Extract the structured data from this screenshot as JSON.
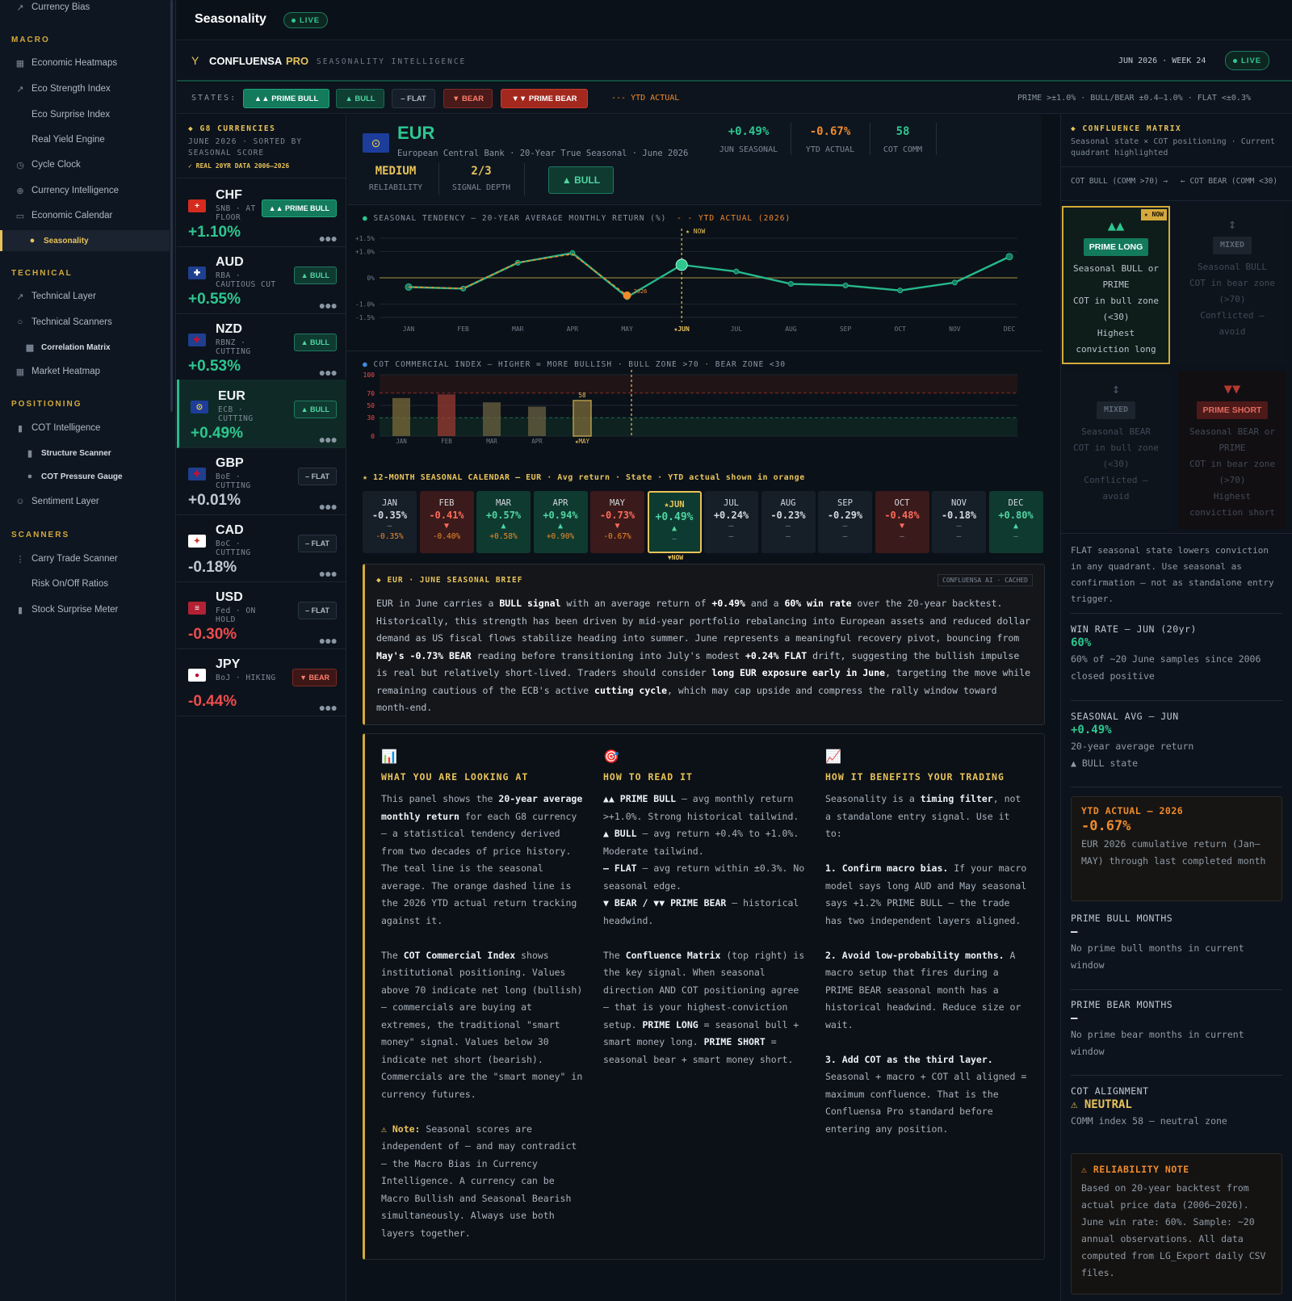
{
  "sidebar": {
    "top_item": "Currency Bias",
    "sections": [
      {
        "title": "MACRO",
        "items": [
          "Economic Heatmaps",
          "Eco Strength Index",
          "Eco Surprise Index",
          "Real Yield Engine",
          "Cycle Clock",
          "Currency Intelligence",
          "Economic Calendar",
          "Seasonality"
        ]
      },
      {
        "title": "TECHNICAL",
        "items": [
          "Technical Layer",
          "Technical Scanners",
          "Correlation Matrix",
          "Market Heatmap"
        ]
      },
      {
        "title": "POSITIONING",
        "items": [
          "COT Intelligence",
          "Structure Scanner",
          "COT Pressure Gauge",
          "Sentiment Layer"
        ]
      },
      {
        "title": "SCANNERS",
        "items": [
          "Carry Trade Scanner",
          "Risk On/Off Ratios",
          "Stock Surprise Meter"
        ]
      }
    ]
  },
  "header": {
    "title": "Seasonality",
    "live": "LIVE"
  },
  "brand": {
    "name": "CONFLUENSA",
    "pro": "PRO",
    "subtitle": "SEASONALITY INTELLIGENCE",
    "date": "JUN 2026 · WEEK 24",
    "live": "LIVE"
  },
  "states": {
    "label": "STATES:",
    "prime_bull": "▲▲ PRIME BULL",
    "bull": "▲ BULL",
    "flat": "– FLAT",
    "bear": "▼ BEAR",
    "prime_bear": "▼▼ PRIME BEAR",
    "ytd": "--- YTD ACTUAL",
    "legend": "PRIME >±1.0% · BULL/BEAR ±0.4–1.0% · FLAT <±0.3%"
  },
  "currencies": {
    "title": "G8 CURRENCIES",
    "subtitle": "JUNE 2026 · SORTED BY SEASONAL SCORE",
    "note": "✓ REAL 20YR DATA 2006–2026",
    "list": [
      {
        "code": "CHF",
        "desc": "SNB · AT FLOOR",
        "value": "+1.10%",
        "badge": "▲▲ PRIME BULL"
      },
      {
        "code": "AUD",
        "desc": "RBA · CAUTIOUS CUT",
        "value": "+0.55%",
        "badge": "▲ BULL"
      },
      {
        "code": "NZD",
        "desc": "RBNZ · CUTTING",
        "value": "+0.53%",
        "badge": "▲ BULL"
      },
      {
        "code": "EUR",
        "desc": "ECB · CUTTING",
        "value": "+0.49%",
        "badge": "▲ BULL"
      },
      {
        "code": "GBP",
        "desc": "BoE · CUTTING",
        "value": "+0.01%",
        "badge": "– FLAT"
      },
      {
        "code": "CAD",
        "desc": "BoC · CUTTING",
        "value": "-0.18%",
        "badge": "– FLAT"
      },
      {
        "code": "USD",
        "desc": "Fed · ON HOLD",
        "value": "-0.30%",
        "badge": "– FLAT"
      },
      {
        "code": "JPY",
        "desc": "BoJ · HIKING",
        "value": "-0.44%",
        "badge": "▼ BEAR"
      }
    ]
  },
  "detail": {
    "code": "EUR",
    "desc": "European Central Bank · 20-Year True Seasonal · June 2026",
    "stats": [
      {
        "value": "+0.49%",
        "label": "JUN SEASONAL"
      },
      {
        "value": "-0.67%",
        "label": "YTD ACTUAL"
      },
      {
        "value": "58",
        "label": "COT COMM"
      }
    ],
    "reliability": "MEDIUM",
    "reliability_label": "RELIABILITY",
    "depth": "2/3",
    "depth_label": "SIGNAL DEPTH",
    "state": "▲ BULL"
  },
  "chart_data": [
    {
      "type": "line",
      "title": "SEASONAL TENDENCY — 20-YEAR AVERAGE MONTHLY RETURN (%)",
      "legend_ytd": "- - YTD ACTUAL (2026)",
      "now_label": "★ NOW",
      "may_tag": "2026",
      "categories": [
        "JAN",
        "FEB",
        "MAR",
        "APR",
        "MAY",
        "★JUN",
        "JUL",
        "AUG",
        "SEP",
        "OCT",
        "NOV",
        "DEC"
      ],
      "yticks": [
        "+1.5%",
        "+1.0%",
        "0%",
        "-1.0%",
        "-1.5%"
      ],
      "ylim": [
        -1.5,
        1.5
      ],
      "series": [
        {
          "name": "Seasonal",
          "values": [
            -0.35,
            -0.41,
            0.57,
            0.94,
            -0.73,
            0.49,
            0.24,
            -0.23,
            -0.29,
            -0.48,
            -0.18,
            0.8
          ]
        },
        {
          "name": "YTD ACTUAL (2026)",
          "values": [
            -0.35,
            -0.4,
            0.58,
            0.9,
            -0.67
          ]
        }
      ]
    },
    {
      "type": "bar",
      "title": "COT COMMERCIAL INDEX — HIGHER = MORE BULLISH · BULL ZONE >70 · BEAR ZONE <30",
      "categories": [
        "JAN",
        "FEB",
        "MAR",
        "APR",
        "★MAY"
      ],
      "values": [
        62,
        68,
        55,
        48,
        58
      ],
      "yticks": [
        "100",
        "70",
        "50",
        "30",
        "0"
      ],
      "ylim": [
        0,
        100
      ],
      "label": "58"
    }
  ],
  "calendar": {
    "title": "★ 12-MONTH SEASONAL CALENDAR — EUR · Avg return · State · YTD actual shown in orange",
    "now": "▼NOW",
    "months": [
      {
        "m": "JAN",
        "v": "-0.35%",
        "a": "–",
        "y": "-0.35%"
      },
      {
        "m": "FEB",
        "v": "-0.41%",
        "a": "▼",
        "y": "-0.40%"
      },
      {
        "m": "MAR",
        "v": "+0.57%",
        "a": "▲",
        "y": "+0.58%"
      },
      {
        "m": "APR",
        "v": "+0.94%",
        "a": "▲",
        "y": "+0.90%"
      },
      {
        "m": "MAY",
        "v": "-0.73%",
        "a": "▼",
        "y": "-0.67%"
      },
      {
        "m": "★JUN",
        "v": "+0.49%",
        "a": "▲",
        "y": "–"
      },
      {
        "m": "JUL",
        "v": "+0.24%",
        "a": "–",
        "y": "–"
      },
      {
        "m": "AUG",
        "v": "-0.23%",
        "a": "–",
        "y": "–"
      },
      {
        "m": "SEP",
        "v": "-0.29%",
        "a": "–",
        "y": "–"
      },
      {
        "m": "OCT",
        "v": "-0.48%",
        "a": "▼",
        "y": "–"
      },
      {
        "m": "NOV",
        "v": "-0.18%",
        "a": "–",
        "y": "–"
      },
      {
        "m": "DEC",
        "v": "+0.80%",
        "a": "▲",
        "y": "–"
      }
    ]
  },
  "brief": {
    "title": "◆ EUR · JUNE SEASONAL BRIEF",
    "tag": "CONFLUENSA AI · CACHED"
  },
  "guide": {
    "c1_title": "WHAT YOU ARE LOOKING AT",
    "c2_title": "HOW TO READ IT",
    "c3_title": "HOW IT BENEFITS YOUR TRADING"
  },
  "matrix": {
    "title": "◆ CONFLUENCE MATRIX",
    "subtitle": "Seasonal state × COT positioning · Current quadrant highlighted",
    "col1": "COT BULL (COMM >70) →",
    "col2": "← COT BEAR (COMM <30)",
    "q1": {
      "arrows": "▲▲",
      "badge": "PRIME LONG",
      "now": "★ NOW",
      "text": [
        "Seasonal BULL or",
        "PRIME",
        "COT in bull zone",
        "(<30)",
        "Highest",
        "conviction long"
      ]
    },
    "q2": {
      "arrows": "↕",
      "badge": "MIXED",
      "text": [
        "Seasonal BULL",
        "COT in bear zone",
        "(>70)",
        "Conflicted —",
        "avoid"
      ]
    },
    "q3": {
      "arrows": "↕",
      "badge": "MIXED",
      "text": [
        "Seasonal BEAR",
        "COT in bull zone",
        "(<30)",
        "Conflicted —",
        "avoid"
      ]
    },
    "q4": {
      "arrows": "▼▼",
      "badge": "PRIME SHORT",
      "text": [
        "Seasonal BEAR or",
        "PRIME",
        "COT in bear zone",
        "(>70)",
        "Highest",
        "conviction short"
      ]
    },
    "flat_note": "FLAT seasonal state lowers conviction in any quadrant. Use seasonal as confirmation — not as standalone entry trigger.",
    "win_label": "WIN RATE — JUN (20yr)",
    "win_value": "60%",
    "win_text": "60% of ~20 June samples since 2006 closed positive",
    "avg_label": "SEASONAL AVG — JUN",
    "avg_value": "+0.49%",
    "avg_text": "20-year average return",
    "avg_state": "▲ BULL state",
    "ytd_label": "YTD ACTUAL — 2026",
    "ytd_value": "-0.67%",
    "ytd_text": "EUR 2026 cumulative return (Jan–MAY) through last completed month",
    "pbm_label": "PRIME BULL MONTHS",
    "pbm_value": "—",
    "pbm_text": "No prime bull months in current window",
    "pbr_label": "PRIME BEAR MONTHS",
    "pbr_value": "—",
    "pbr_text": "No prime bear months in current window",
    "cot_label": "COT ALIGNMENT",
    "cot_value": "⚠ NEUTRAL",
    "cot_text": "COMM index 58 — neutral zone",
    "rel_label": "⚠ RELIABILITY NOTE",
    "rel_text": "Based on 20-year backtest from actual price data (2006–2026). June win rate: 60%. Sample: ~20 annual observations. All data computed from LG_Export daily CSV files."
  }
}
